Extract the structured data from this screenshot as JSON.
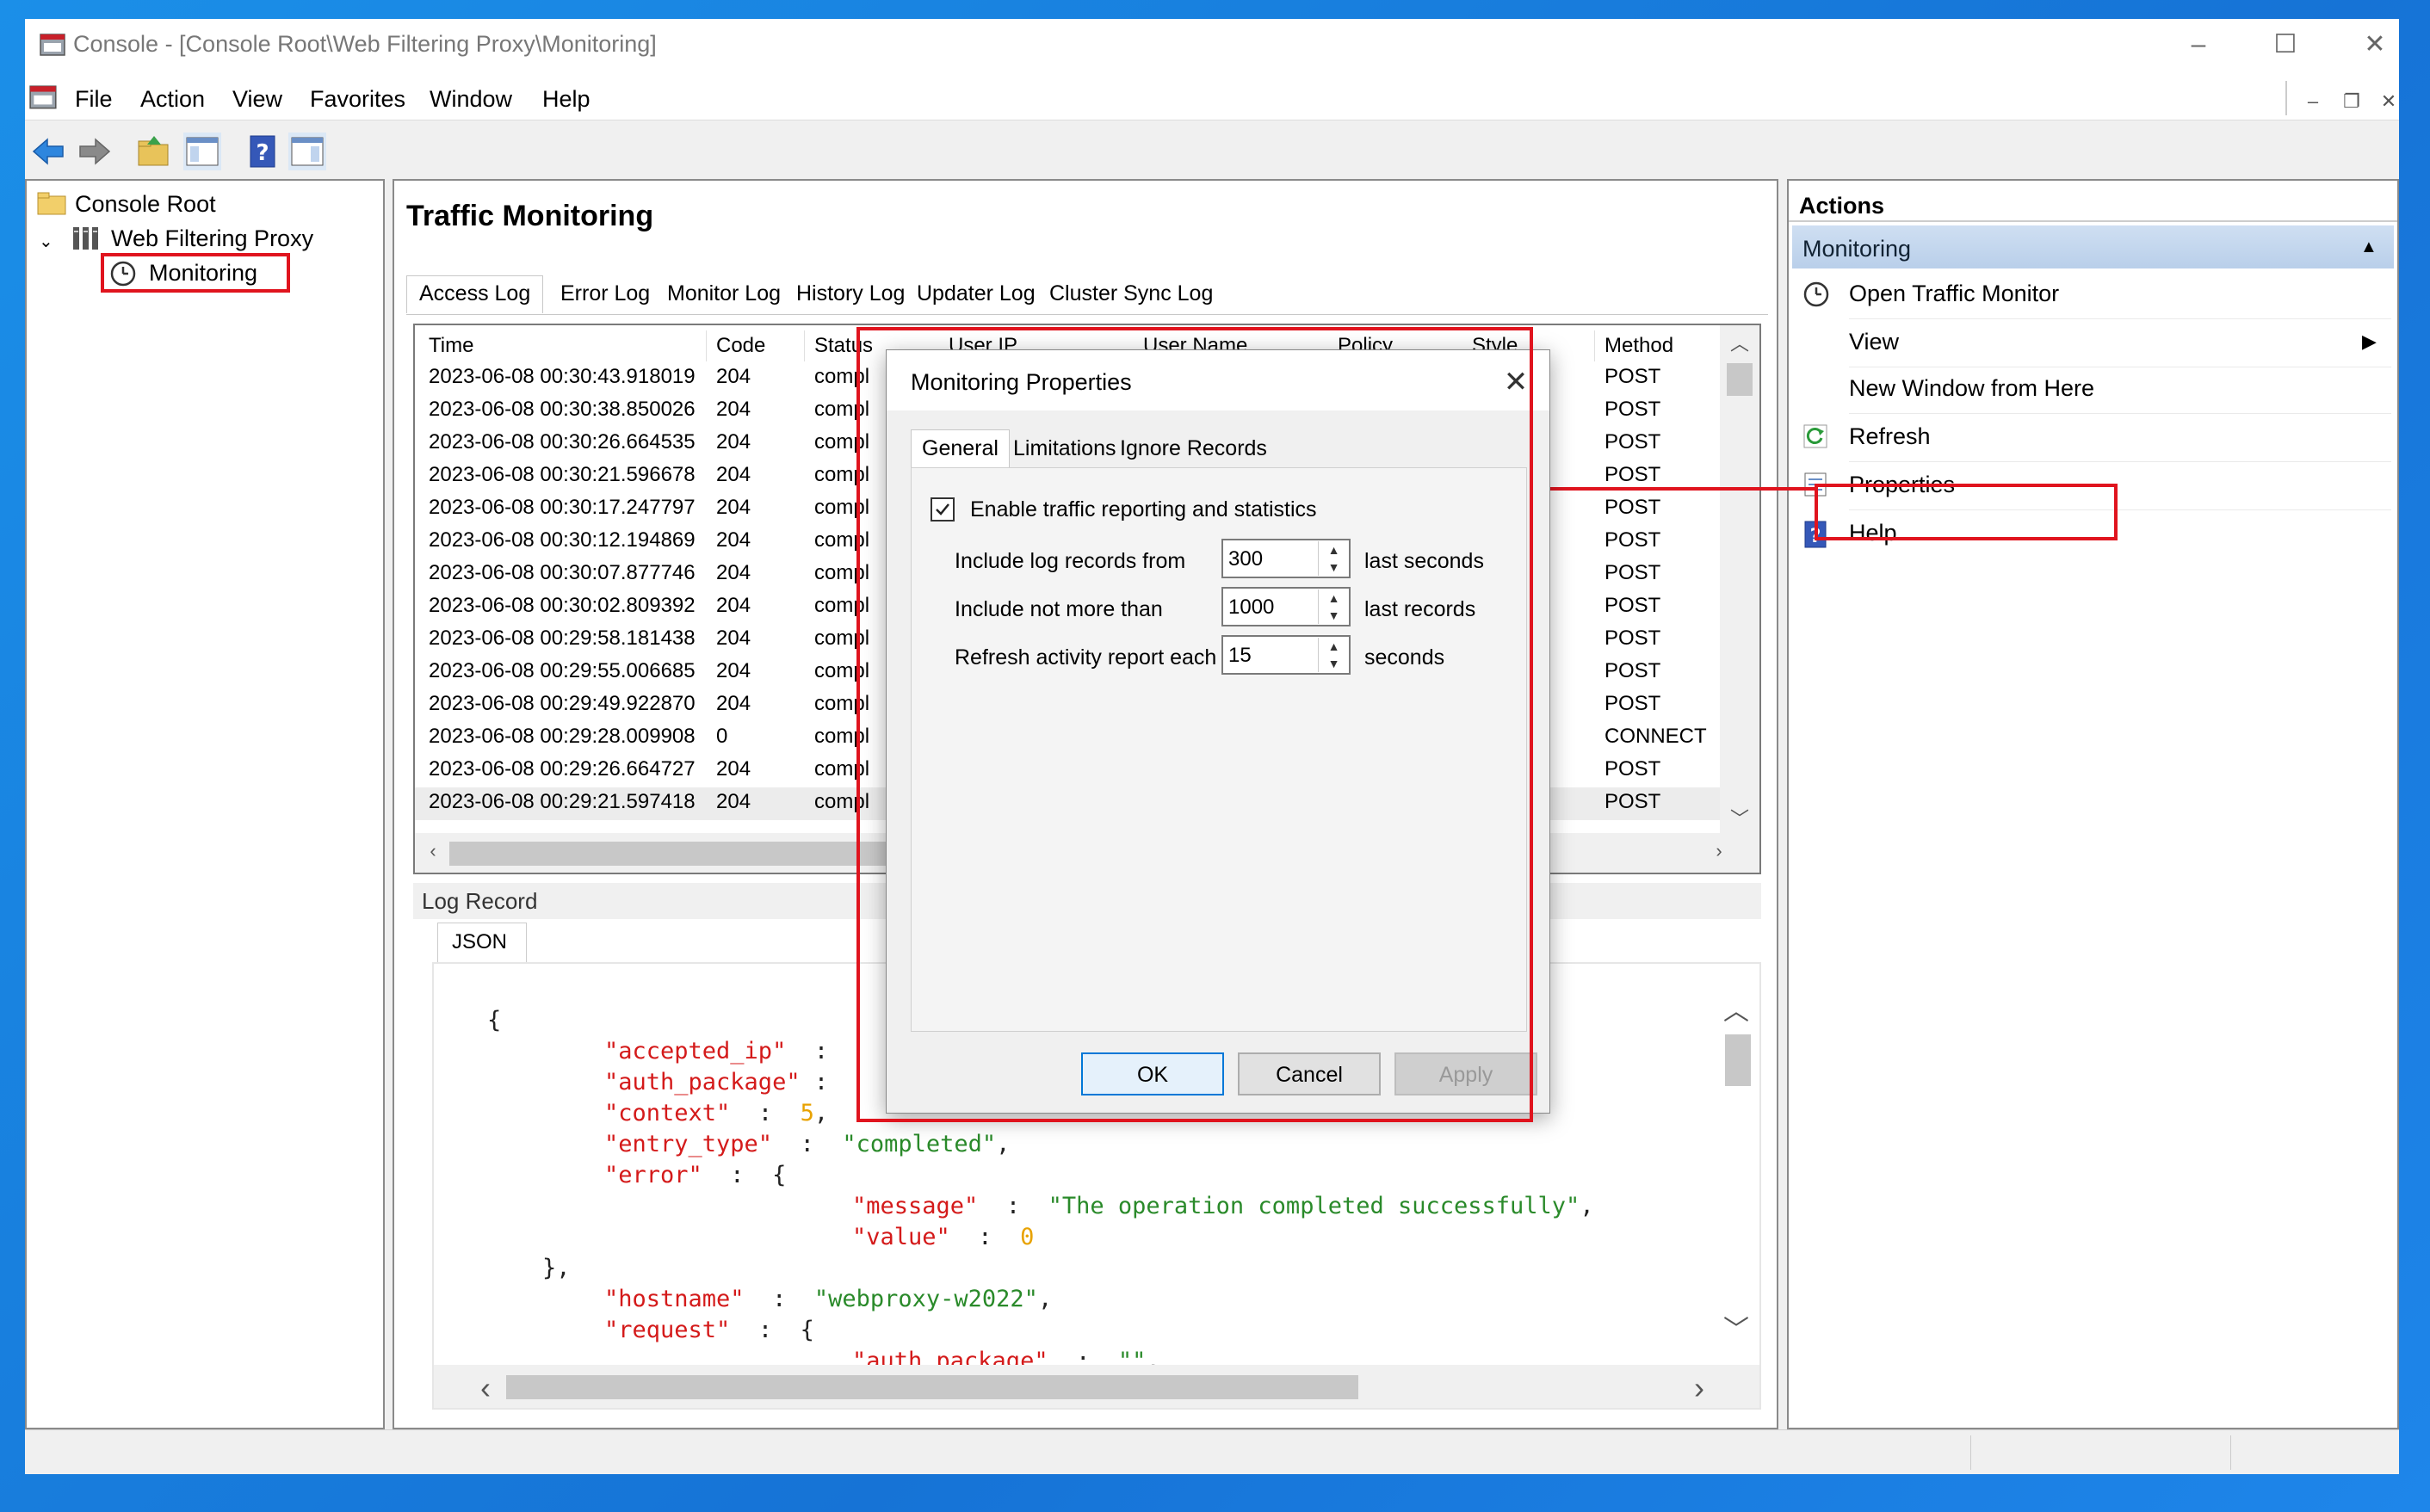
{
  "window": {
    "title": "Console - [Console Root\\Web Filtering Proxy\\Monitoring]"
  },
  "menu": [
    "File",
    "Action",
    "View",
    "Favorites",
    "Window",
    "Help"
  ],
  "tree": {
    "root": "Console Root",
    "proxy": "Web Filtering Proxy",
    "monitoring": "Monitoring"
  },
  "center": {
    "title": "Traffic Monitoring",
    "tabs": [
      "Access Log",
      "Error Log",
      "Monitor Log",
      "History Log",
      "Updater Log",
      "Cluster Sync Log"
    ],
    "columns": [
      "Time",
      "Code",
      "Status",
      "User IP",
      "User Name",
      "Policy",
      "Style",
      "Method"
    ],
    "rows": [
      {
        "time": "2023-06-08 00:30:43.918019",
        "code": "204",
        "status": "compl",
        "method": "POST"
      },
      {
        "time": "2023-06-08 00:30:38.850026",
        "code": "204",
        "status": "compl",
        "method": "POST"
      },
      {
        "time": "2023-06-08 00:30:26.664535",
        "code": "204",
        "status": "compl",
        "method": "POST"
      },
      {
        "time": "2023-06-08 00:30:21.596678",
        "code": "204",
        "status": "compl",
        "method": "POST"
      },
      {
        "time": "2023-06-08 00:30:17.247797",
        "code": "204",
        "status": "compl",
        "method": "POST"
      },
      {
        "time": "2023-06-08 00:30:12.194869",
        "code": "204",
        "status": "compl",
        "method": "POST"
      },
      {
        "time": "2023-06-08 00:30:07.877746",
        "code": "204",
        "status": "compl",
        "method": "POST"
      },
      {
        "time": "2023-06-08 00:30:02.809392",
        "code": "204",
        "status": "compl",
        "method": "POST"
      },
      {
        "time": "2023-06-08 00:29:58.181438",
        "code": "204",
        "status": "compl",
        "method": "POST"
      },
      {
        "time": "2023-06-08 00:29:55.006685",
        "code": "204",
        "status": "compl",
        "method": "POST"
      },
      {
        "time": "2023-06-08 00:29:49.922870",
        "code": "204",
        "status": "compl",
        "method": "POST"
      },
      {
        "time": "2023-06-08 00:29:28.009908",
        "code": "0",
        "status": "compl",
        "method": "CONNECT"
      },
      {
        "time": "2023-06-08 00:29:26.664727",
        "code": "204",
        "status": "compl",
        "method": "POST"
      },
      {
        "time": "2023-06-08 00:29:21.597418",
        "code": "204",
        "status": "compl",
        "method": "POST"
      }
    ],
    "log_record_title": "Log Record",
    "json_tab": "JSON",
    "json": {
      "open": "{",
      "accepted_ip": "\"accepted_ip\"",
      "auth_package": "\"auth_package\"",
      "context": "\"context\"",
      "context_val": "5",
      "entry_type": "\"entry_type\"",
      "entry_type_val": "\"completed\"",
      "error": "\"error\"",
      "message": "\"message\"",
      "message_val": "\"The operation completed successfully\"",
      "value": "\"value\"",
      "value_val": "0",
      "close_inner": "},",
      "hostname": "\"hostname\"",
      "hostname_val": "\"webproxy-w2022\"",
      "request": "\"request\"",
      "auth_package2": "\"auth_package\"",
      "auth_package2_val": "\"\""
    }
  },
  "actions": {
    "header": "Actions",
    "section": "Monitoring",
    "items": [
      "Open Traffic Monitor",
      "View",
      "New Window from Here",
      "Refresh",
      "Properties",
      "Help"
    ]
  },
  "dialog": {
    "title": "Monitoring Properties",
    "tabs": [
      "General",
      "Limitations",
      "Ignore Records"
    ],
    "enable_label": "Enable traffic reporting and statistics",
    "enable_checked": true,
    "fields": [
      {
        "label": "Include log records from",
        "value": "300",
        "unit": "last seconds"
      },
      {
        "label": "Include not more than",
        "value": "1000",
        "unit": "last records"
      },
      {
        "label": "Refresh activity report each",
        "value": "15",
        "unit": "seconds"
      }
    ],
    "ok": "OK",
    "cancel": "Cancel",
    "apply": "Apply"
  },
  "colors": {
    "highlight": "#e0141e",
    "accent": "#0078d7"
  }
}
